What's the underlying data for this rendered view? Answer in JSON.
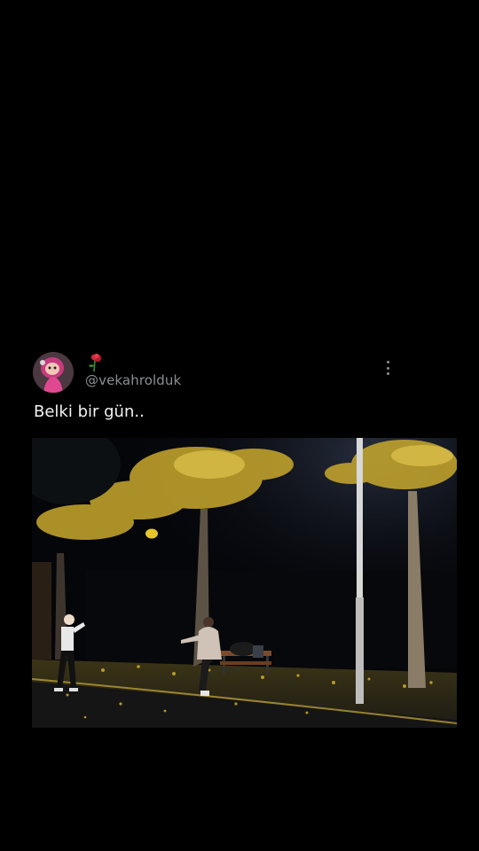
{
  "post": {
    "display_name_emoji": "rose-emoji",
    "handle": "@vekahrolduk",
    "text": "Belki bir gün..",
    "media": {
      "description_icon": "photo-night-park"
    }
  },
  "colors": {
    "background": "#000000",
    "handle": "#8b8f94",
    "text": "#f2f2f2",
    "leaf_yellow": "#d7b531"
  }
}
